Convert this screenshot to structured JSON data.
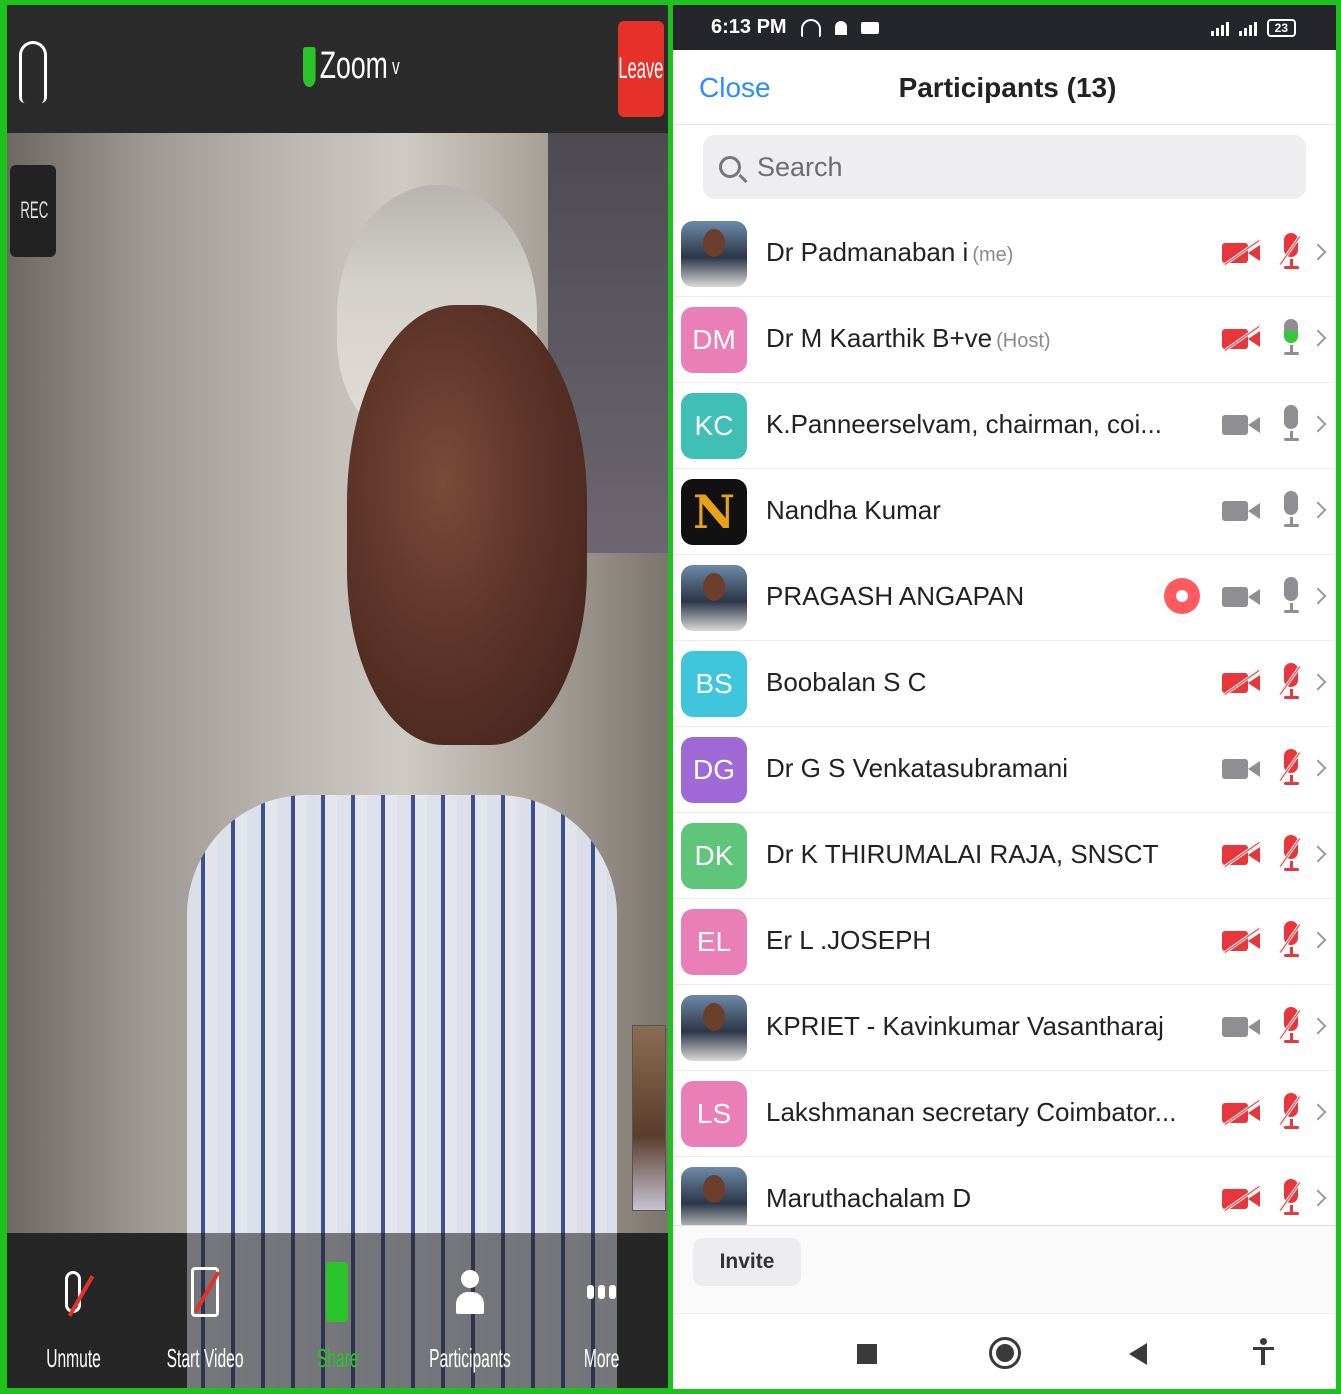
{
  "video_screen": {
    "app_title": "Zoom",
    "title_chevron": "v",
    "leave_label": "Leave",
    "rec_label": "REC",
    "toolbar": [
      {
        "label": "Unmute",
        "icon": "mic-muted-icon"
      },
      {
        "label": "Start Video",
        "icon": "camera-off-icon"
      },
      {
        "label": "Share",
        "icon": "share-icon"
      },
      {
        "label": "Participants",
        "icon": "participants-icon"
      },
      {
        "label": "More",
        "icon": "more-icon"
      }
    ]
  },
  "status_bar": {
    "time": "6:13 PM",
    "battery": "23"
  },
  "participants_panel": {
    "close_label": "Close",
    "title": "Participants (13)",
    "search_placeholder": "Search",
    "invite_label": "Invite",
    "participants": [
      {
        "avatar_text": "",
        "avatar_type": "photo",
        "name": "Dr Padmanaban i",
        "tag": "(me)",
        "video": "off",
        "audio": "off",
        "recording": false
      },
      {
        "avatar_text": "DM",
        "avatar_type": "initials",
        "avatar_color": "#ea7fb7",
        "name": "Dr M Kaarthik B+ve",
        "tag": "(Host)",
        "video": "off",
        "audio": "talking",
        "recording": false
      },
      {
        "avatar_text": "KC",
        "avatar_type": "initials",
        "avatar_color": "#3fbfb5",
        "name": "K.Panneerselvam, chairman, coi...",
        "tag": "",
        "video": "on",
        "audio": "on",
        "recording": false
      },
      {
        "avatar_text": "N",
        "avatar_type": "logo",
        "name": "Nandha Kumar",
        "tag": "",
        "video": "on",
        "audio": "on",
        "recording": false
      },
      {
        "avatar_text": "",
        "avatar_type": "photo",
        "name": "PRAGASH ANGAPAN",
        "tag": "",
        "video": "on",
        "audio": "on",
        "recording": true
      },
      {
        "avatar_text": "BS",
        "avatar_type": "initials",
        "avatar_color": "#3fc6dd",
        "name": "Boobalan S C",
        "tag": "",
        "video": "off",
        "audio": "off",
        "recording": false
      },
      {
        "avatar_text": "DG",
        "avatar_type": "initials",
        "avatar_color": "#a06ad6",
        "name": "Dr G S Venkatasubramani",
        "tag": "",
        "video": "on",
        "audio": "off",
        "recording": false
      },
      {
        "avatar_text": "DK",
        "avatar_type": "initials",
        "avatar_color": "#5fc57a",
        "name": "Dr K THIRUMALAI RAJA, SNSCT",
        "tag": "",
        "video": "off",
        "audio": "off",
        "recording": false
      },
      {
        "avatar_text": "EL",
        "avatar_type": "initials",
        "avatar_color": "#ea7fb7",
        "name": "Er L .JOSEPH",
        "tag": "",
        "video": "off",
        "audio": "off",
        "recording": false
      },
      {
        "avatar_text": "",
        "avatar_type": "photo",
        "name": "KPRIET - Kavinkumar Vasantharaj",
        "tag": "",
        "video": "on",
        "audio": "off",
        "recording": false
      },
      {
        "avatar_text": "LS",
        "avatar_type": "initials",
        "avatar_color": "#ea7fb7",
        "name": "Lakshmanan secretary Coimbator...",
        "tag": "",
        "video": "off",
        "audio": "off",
        "recording": false
      },
      {
        "avatar_text": "",
        "avatar_type": "photo",
        "name": "Maruthachalam D",
        "tag": "",
        "video": "off",
        "audio": "off",
        "recording": false
      }
    ]
  }
}
